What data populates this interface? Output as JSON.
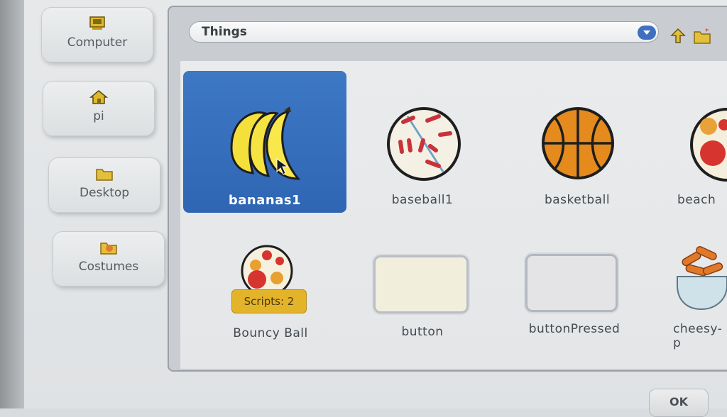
{
  "locations": [
    {
      "label": "Computer",
      "icon": "computer-icon"
    },
    {
      "label": "pi",
      "icon": "home-icon"
    },
    {
      "label": "Desktop",
      "icon": "folder-icon"
    },
    {
      "label": "Costumes",
      "icon": "costumes-icon"
    }
  ],
  "path": {
    "current": "Things"
  },
  "toolbar": {
    "up_icon": "up-arrow-icon",
    "new_folder_icon": "new-folder-icon"
  },
  "items": [
    {
      "label": "bananas1",
      "selected": true
    },
    {
      "label": "baseball1"
    },
    {
      "label": "basketball"
    },
    {
      "label": "beach"
    },
    {
      "label": "Bouncy Ball",
      "badge": "Scripts: 2"
    },
    {
      "label": "button"
    },
    {
      "label": "buttonPressed"
    },
    {
      "label": "cheesy-p"
    }
  ],
  "buttons": {
    "ok": "OK"
  },
  "colors": {
    "selection": "#3d78c5",
    "badge": "#e3b32a"
  }
}
